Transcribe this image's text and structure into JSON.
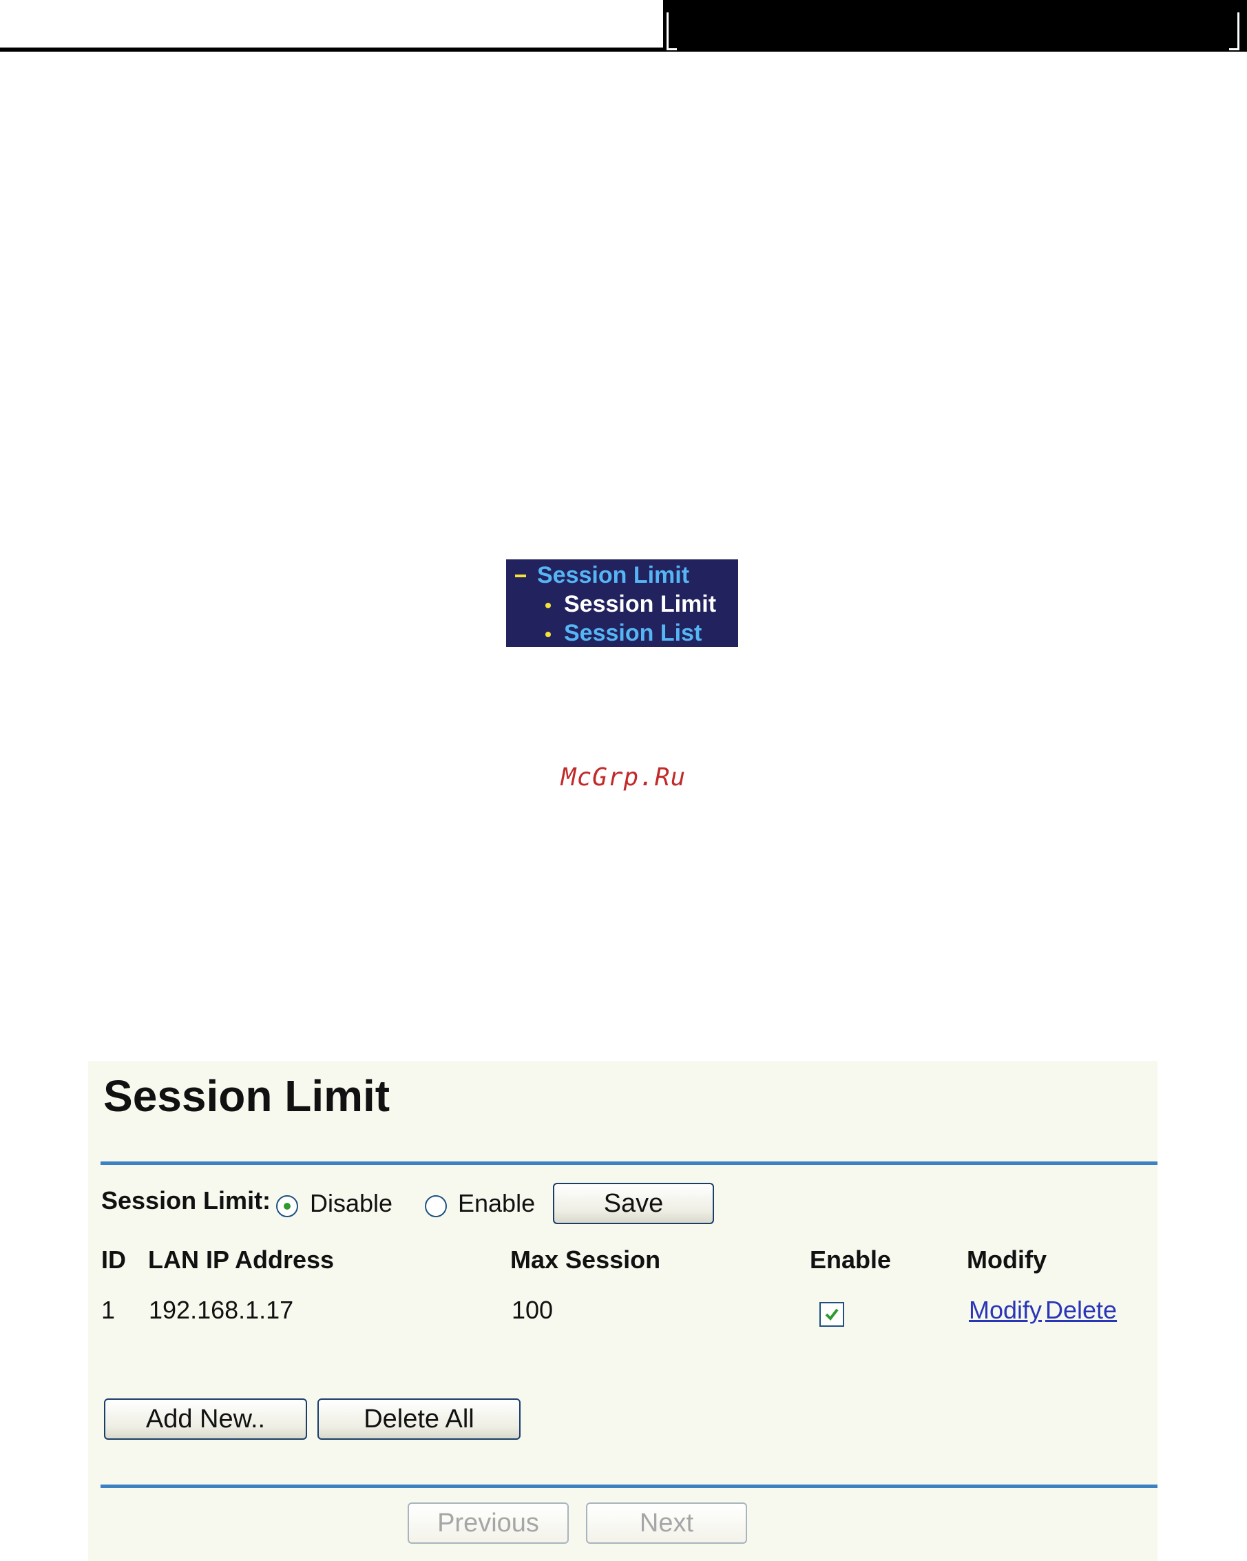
{
  "menu": {
    "parent": "Session Limit",
    "items": [
      {
        "label": "Session Limit",
        "active": true
      },
      {
        "label": "Session List",
        "active": false
      }
    ]
  },
  "watermark": "McGrp.Ru",
  "panel": {
    "title": "Session Limit",
    "setting": {
      "label": "Session Limit:",
      "options": [
        "Disable",
        "Enable"
      ],
      "selected": "Disable",
      "save_label": "Save"
    },
    "table": {
      "headers": [
        "ID",
        "LAN IP Address",
        "Max Session",
        "Enable",
        "Modify"
      ],
      "rows": [
        {
          "id": "1",
          "ip": "192.168.1.17",
          "max_session": "100",
          "enabled": true,
          "modify_label": "Modify",
          "delete_label": "Delete"
        }
      ]
    },
    "add_new_label": "Add New..",
    "delete_all_label": "Delete All",
    "previous_label": "Previous",
    "next_label": "Next"
  },
  "colors": {
    "menu_bg": "#22225e",
    "menu_link": "#56b6f4",
    "menu_bullet": "#f5e23a",
    "panel_bg": "#f8f9ee",
    "divider": "#3c82c2",
    "link": "#2a36b8",
    "watermark": "#c12a2a"
  }
}
